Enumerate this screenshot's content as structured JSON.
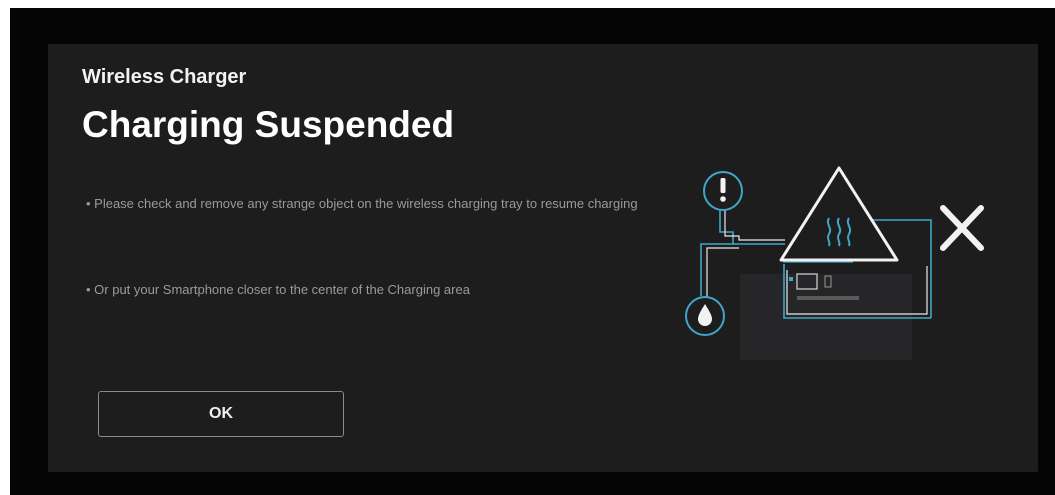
{
  "dialog": {
    "subtitle": "Wireless Charger",
    "title": "Charging Suspended",
    "messages": [
      "• Please check and remove any strange object on the wireless charging tray to resume charging",
      "• Or put your Smartphone closer to the center of the Charging area"
    ],
    "ok_label": "OK"
  },
  "illustration": {
    "icons": [
      "exclamation-icon",
      "warning-heat-icon",
      "close-x-icon",
      "drop-icon",
      "phone-pad-icon"
    ],
    "accent_color": "#3fa6c8",
    "icon_color": "#e9e9e9"
  }
}
